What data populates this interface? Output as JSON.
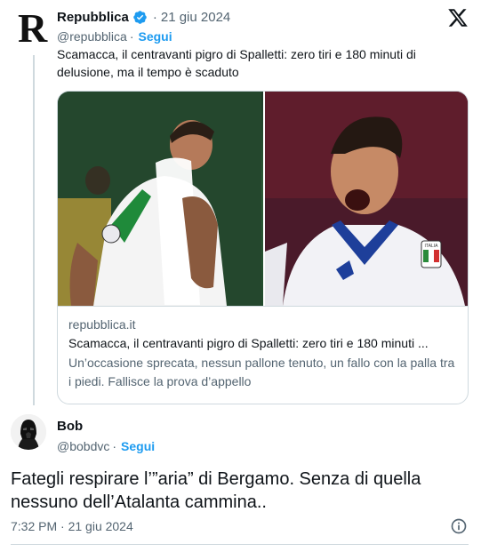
{
  "parent": {
    "avatar_letter": "R",
    "name": "Repubblica",
    "separator": "·",
    "date": "21 giu 2024",
    "handle": "@repubblica",
    "handle_sep": "·",
    "follow": "Segui",
    "text": "Scamacca, il centravanti pigro di Spalletti: zero tiri e 180 minuti di delusione, ma il tempo è scaduto",
    "card": {
      "domain": "repubblica.it",
      "title": "Scamacca, il centravanti pigro di Spalletti: zero tiri e 180 minuti ...",
      "description": "Un’occasione sprecata, nessun pallone tenuto, un fallo con la palla tra i piedi. Fallisce la prova d’appello",
      "images": [
        "player-dejected-photo",
        "player-celebrating-photo"
      ],
      "crest_text": "ITALIA"
    }
  },
  "reply": {
    "name": "Bob",
    "handle": "@bobdvc",
    "handle_sep": "·",
    "follow": "Segui",
    "text": "Fategli respirare l’”aria” di Bergamo. Senza di quella nessuno dell’Atalanta cammina..",
    "timestamp": "7:32 PM · 21 giu 2024"
  },
  "icons": {
    "verified": "verified-badge-icon",
    "x_logo": "x-logo-icon",
    "info": "info-icon"
  },
  "colors": {
    "link": "#1d9bf0",
    "secondary_text": "#536471",
    "border": "#cfd9de",
    "verified": "#1d9bf0"
  }
}
